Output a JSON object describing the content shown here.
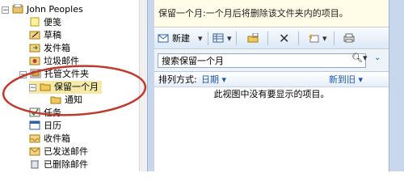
{
  "nav": {
    "root": "John Peoples",
    "items": [
      {
        "label": "便笺"
      },
      {
        "label": "草稿"
      },
      {
        "label": "发件箱"
      },
      {
        "label": "垃圾邮件"
      },
      {
        "label": "托管文件夹"
      },
      {
        "label": "保留一个月"
      },
      {
        "label": "通知"
      },
      {
        "label": "任务"
      },
      {
        "label": "日历"
      },
      {
        "label": "收件箱"
      },
      {
        "label": "已发送邮件"
      },
      {
        "label": "已删除邮件"
      }
    ]
  },
  "infobar": {
    "text": "保留一个月:一个月后将删除该文件夹内的项目。"
  },
  "toolbar": {
    "new_label": "新建"
  },
  "search": {
    "placeholder": "搜索保留一个月"
  },
  "sort": {
    "label": "排列方式:",
    "field": "日期",
    "order": "新到旧"
  },
  "content": {
    "empty_message": "此视图中没有要显示的项目。"
  },
  "colors": {
    "annotation": "#c0392b",
    "selection": "#f5e9a8",
    "accent": "#1a56b5"
  }
}
